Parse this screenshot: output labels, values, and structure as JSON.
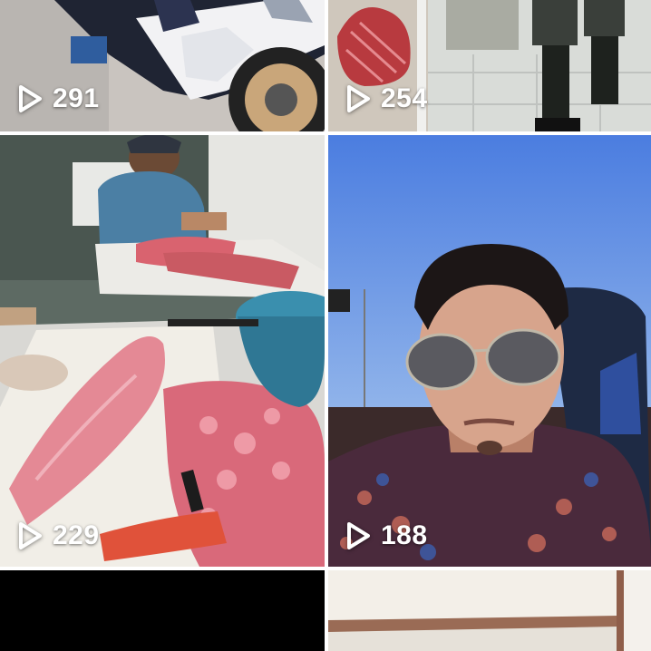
{
  "feed": {
    "tiles": [
      {
        "views": "291",
        "thumb_icon": "motorcycle-thumbnail"
      },
      {
        "views": "254",
        "thumb_icon": "market-floor-thumbnail"
      },
      {
        "views": "229",
        "thumb_icon": "fish-cutting-thumbnail"
      },
      {
        "views": "188",
        "thumb_icon": "selfie-sunglasses-thumbnail"
      },
      {
        "views": "",
        "thumb_icon": "black-thumbnail"
      },
      {
        "views": "",
        "thumb_icon": "room-wall-thumbnail"
      }
    ],
    "colors": {
      "overlay_text": "#ffffff",
      "grid_gap": "#ffffff"
    }
  }
}
